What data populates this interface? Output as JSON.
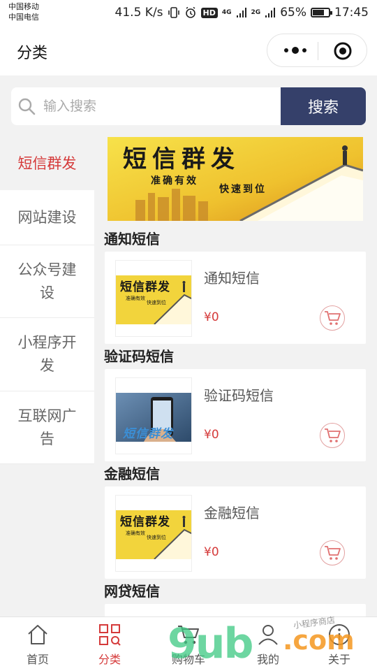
{
  "status_bar": {
    "carrier_1": "中国移动",
    "carrier_2": "中国电信",
    "speed": "41.5 K/s",
    "hd": "HD",
    "net_1": "4G",
    "net_2": "2G",
    "battery": "65%",
    "time": "17:45"
  },
  "header": {
    "title": "分类"
  },
  "search": {
    "placeholder": "输入搜索",
    "button_label": "搜索"
  },
  "sidebar": {
    "items": [
      {
        "label": "短信群发",
        "active": true
      },
      {
        "label": "网站建设",
        "active": false
      },
      {
        "label": "公众号建设",
        "active": false
      },
      {
        "label": "小程序开发",
        "active": false
      },
      {
        "label": "互联网广告",
        "active": false
      }
    ]
  },
  "banner": {
    "headline": "短信群发",
    "tagline_1": "准确有效",
    "tagline_2": "快速到位"
  },
  "sections": [
    {
      "title": "通知短信",
      "product": {
        "name": "通知短信",
        "price": "¥0",
        "image": "sms-banner"
      }
    },
    {
      "title": "验证码短信",
      "product": {
        "name": "验证码短信",
        "price": "¥0",
        "image": "phone-photo"
      }
    },
    {
      "title": "金融短信",
      "product": {
        "name": "金融短信",
        "price": "¥0",
        "image": "sms-banner"
      }
    },
    {
      "title": "网贷短信"
    }
  ],
  "thumb_text": {
    "headline": "短信群发",
    "tagline_1": "准确有效",
    "tagline_2": "快速到位",
    "phone_caption": "短信群发"
  },
  "tabbar": {
    "tabs": [
      {
        "label": "首页",
        "icon": "home-icon"
      },
      {
        "label": "分类",
        "icon": "category-icon",
        "active": true
      },
      {
        "label": "购物车",
        "icon": "cart-icon"
      },
      {
        "label": "我的",
        "icon": "user-icon"
      },
      {
        "label": "关于",
        "icon": "info-icon"
      }
    ]
  },
  "watermark": {
    "brand": "9ub",
    "domain": ".com",
    "subtitle": "小程序商店"
  },
  "colors": {
    "accent": "#d53a3a",
    "search_button": "#35406a",
    "banner_yellow": "#f2d43c"
  }
}
